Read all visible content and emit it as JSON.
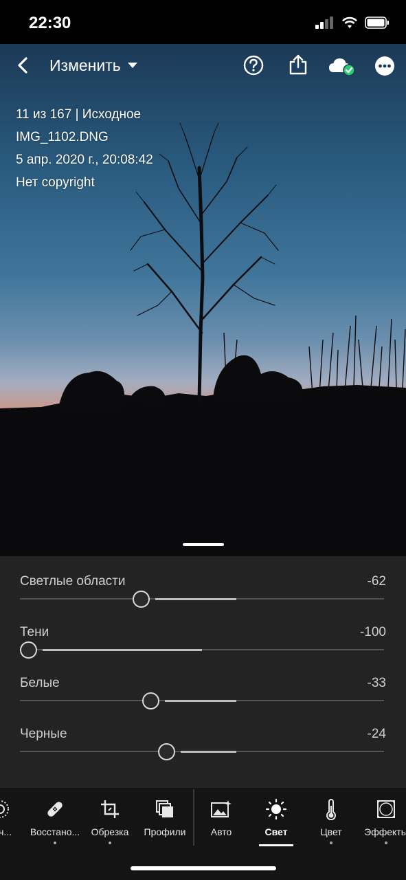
{
  "status_bar": {
    "time": "22:30"
  },
  "header": {
    "title": "Изменить"
  },
  "photo_info": {
    "line1": "11 из 167 | Исходное",
    "line2": "IMG_1102.DNG",
    "line3": "5 апр. 2020 г., 20:08:42",
    "line4": "Нет copyright"
  },
  "sliders": [
    {
      "label": "Светлые области",
      "value": "-62",
      "position": 0.31
    },
    {
      "label": "Тени",
      "value": "-100",
      "position": 0.0
    },
    {
      "label": "Белые",
      "value": "-33",
      "position": 0.335
    },
    {
      "label": "Черные",
      "value": "-24",
      "position": 0.38
    }
  ],
  "tools": [
    {
      "label": "роч...",
      "icon": "selective-icon"
    },
    {
      "label": "Восстано...",
      "icon": "bandage-icon"
    },
    {
      "label": "Обрезка",
      "icon": "crop-icon"
    },
    {
      "label": "Профили",
      "icon": "profiles-icon"
    },
    {
      "label": "Авто",
      "icon": "auto-icon"
    },
    {
      "label": "Свет",
      "icon": "light-icon",
      "active": true
    },
    {
      "label": "Цвет",
      "icon": "thermometer-icon"
    },
    {
      "label": "Эффекты",
      "icon": "vignette-icon"
    }
  ],
  "colors": {
    "panel": "#232323",
    "toolbar": "#141414",
    "cloud_check": "#2ecc71"
  }
}
